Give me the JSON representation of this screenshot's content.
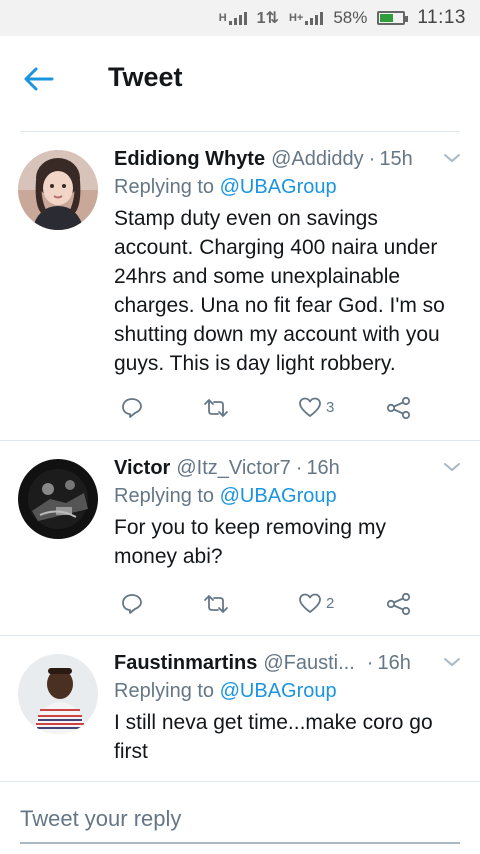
{
  "status_bar": {
    "signal1_label": "H",
    "data_label": "1⇅",
    "signal2_label": "H+",
    "battery_percent": "58%",
    "battery_level": 0.58,
    "time": "11:13"
  },
  "header": {
    "title": "Tweet"
  },
  "colors": {
    "accent": "#1b95e0",
    "muted": "#657786",
    "divider": "#e1e8ed"
  },
  "tweets": [
    {
      "name": "Edidiong Whyte",
      "handle": "@Addiddy",
      "dot": "·",
      "time": "15h",
      "replying_prefix": "Replying to",
      "replying_to": "@UBAGroup",
      "text": "Stamp duty even on savings account. Charging 400 naira under 24hrs and some unexplainable charges. Una no fit fear God. I'm so shutting down my account with you guys. This is day light robbery.",
      "likes": "3"
    },
    {
      "name": "Victor",
      "handle": "@Itz_Victor7",
      "dot": "·",
      "time": "16h",
      "replying_prefix": "Replying to",
      "replying_to": "@UBAGroup",
      "text": "For you to keep removing my money abi?",
      "likes": "2"
    },
    {
      "name": "Faustinmartins",
      "handle": "@Fausti...",
      "dot": "·",
      "time": "16h",
      "replying_prefix": "Replying to",
      "replying_to": "@UBAGroup",
      "text": "I still neva get time...make coro go first"
    }
  ],
  "reply_box": {
    "placeholder": "Tweet your reply"
  },
  "icons": [
    "back-arrow-icon",
    "chevron-down-icon",
    "reply-icon",
    "retweet-icon",
    "like-icon",
    "share-icon"
  ]
}
